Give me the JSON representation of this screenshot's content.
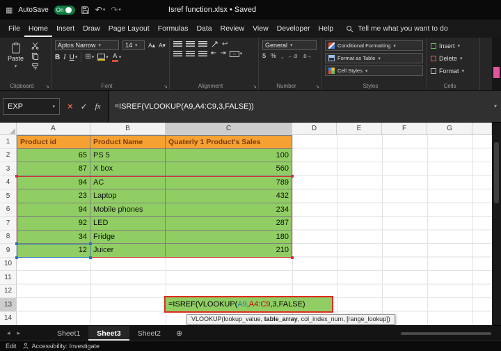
{
  "titlebar": {
    "autosave_label": "AutoSave",
    "autosave_state": "On",
    "title": "Isref function.xlsx • Saved"
  },
  "menubar": {
    "tabs": [
      "File",
      "Home",
      "Insert",
      "Draw",
      "Page Layout",
      "Formulas",
      "Data",
      "Review",
      "View",
      "Developer",
      "Help"
    ],
    "active": "Home",
    "tell_me": "Tell me what you want to do"
  },
  "ribbon": {
    "paste_label": "Paste",
    "font_name": "Aptos Narrow",
    "font_size": "14",
    "bold": "B",
    "italic": "I",
    "underline": "U",
    "font_color_letter": "A",
    "number_format": "General",
    "styles_buttons": [
      "Conditional Formatting",
      "Format as Table",
      "Cell Styles"
    ],
    "cells_buttons": [
      "Insert",
      "Delete",
      "Format"
    ],
    "group_labels": {
      "clipboard": "Clipboard",
      "font": "Font",
      "alignment": "Alignment",
      "number": "Number",
      "styles": "Styles",
      "cells": "Cells"
    }
  },
  "formula_bar": {
    "name_box": "EXP",
    "formula": "=ISREF(VLOOKUP(A9,A4:C9,3,FALSE))"
  },
  "sheet": {
    "col_headers": [
      "A",
      "B",
      "C",
      "D",
      "E",
      "F",
      "G"
    ],
    "row_numbers": [
      "1",
      "2",
      "3",
      "4",
      "5",
      "6",
      "7",
      "8",
      "9",
      "10",
      "11",
      "12",
      "13",
      "14"
    ],
    "table_headers": [
      "Product id",
      "Product Name",
      "Quaterly 1 Product's Sales"
    ],
    "products": [
      {
        "id": "65",
        "name": "PS 5",
        "sales": "100"
      },
      {
        "id": "87",
        "name": "X box",
        "sales": "560"
      },
      {
        "id": "94",
        "name": "AC",
        "sales": "789"
      },
      {
        "id": "23",
        "name": "Laptop",
        "sales": "432"
      },
      {
        "id": "94",
        "name": "Mobile phones",
        "sales": "234"
      },
      {
        "id": "92",
        "name": "LED",
        "sales": "287"
      },
      {
        "id": "34",
        "name": "Fridge",
        "sales": "180"
      },
      {
        "id": "12",
        "name": "Juicer",
        "sales": "210"
      }
    ],
    "edit_formula": {
      "part1": "=ISREF(VLOOKUP(",
      "ref1": "A9",
      "comma": ",",
      "ref2": "A4:C9",
      "part2": ",3,FALSE",
      "part3": ")"
    },
    "tooltip": {
      "pre": "VLOOKUP(lookup_value, ",
      "bold": "table_array",
      "post": ", col_index_num, [range_lookup])"
    }
  },
  "sheet_tabs": {
    "tabs": [
      "Sheet1",
      "Sheet3",
      "Sheet2"
    ],
    "active": "Sheet3"
  },
  "status_bar": {
    "mode": "Edit",
    "accessibility": "Accessibility: Investigate"
  },
  "icons": {
    "caret": "▾",
    "launcher": "↘",
    "undo": "↶",
    "redo": "↷",
    "close": "×",
    "check": "✓",
    "fx": "fx",
    "borders": "⊞",
    "merge": "↔",
    "wrap": "↩",
    "indent_left": "⇤",
    "indent_right": "⇥",
    "dollar": "$",
    "percent": "%",
    "comma": ",",
    "dec_inc": "←.0",
    "dec_dec": ".0→",
    "font_grow": "A▴",
    "font_shrink": "A▾",
    "add_sheet": "⊕",
    "nav_left": "◂",
    "nav_right": "▸",
    "app": "▦"
  },
  "colors": {
    "table_header_fill": "#F5A233",
    "table_header_text": "#7F3807",
    "data_fill": "#90CE63",
    "edit_border": "#E02B20",
    "ref_blue": "#2E75B6",
    "ref_red": "#C00000",
    "autosave_green": "#107C41"
  }
}
